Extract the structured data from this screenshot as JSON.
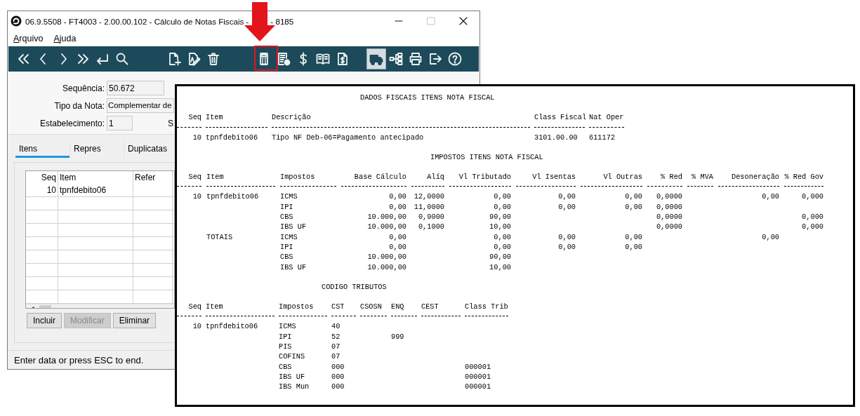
{
  "window": {
    "title": "06.9.5508 - FT4003 - 2.00.00.102 - Cálculo de Notas Fiscais -",
    "title_continued": "- 8185",
    "controls": [
      {
        "kind": "minimize",
        "disabled": false
      },
      {
        "kind": "maximize",
        "disabled": true
      },
      {
        "kind": "close",
        "disabled": false
      }
    ]
  },
  "menu": [
    {
      "label": "Arquivo"
    },
    {
      "label": "Ajuda"
    }
  ],
  "toolbar_groups": [
    {
      "buttons": [
        {
          "kind": "first",
          "selected": false
        },
        {
          "kind": "prev",
          "selected": false
        },
        {
          "kind": "next",
          "selected": false
        },
        {
          "kind": "last",
          "selected": false
        },
        {
          "kind": "enter",
          "selected": false
        },
        {
          "kind": "search",
          "selected": false
        }
      ]
    },
    {
      "buttons": [
        {
          "kind": "new",
          "selected": false
        },
        {
          "kind": "edit",
          "selected": false
        },
        {
          "kind": "delete",
          "selected": false
        }
      ]
    },
    {
      "buttons": [
        {
          "kind": "calculator",
          "selected": false
        },
        {
          "kind": "invoice",
          "selected": false
        },
        {
          "kind": "money",
          "selected": false
        },
        {
          "kind": "book",
          "selected": false
        },
        {
          "kind": "document",
          "selected": false
        }
      ]
    },
    {
      "buttons": [
        {
          "kind": "truck",
          "selected": true
        },
        {
          "kind": "tree",
          "selected": false
        },
        {
          "kind": "print",
          "selected": false
        },
        {
          "kind": "exit",
          "selected": false
        },
        {
          "kind": "help",
          "selected": false
        }
      ]
    }
  ],
  "form": {
    "rows": [
      [
        {
          "label": "Sequência:",
          "value": "50.672"
        }
      ],
      [
        {
          "label": "Tipo da Nota:",
          "value": "Complementar de"
        }
      ],
      [
        {
          "label": "Estabelecimento:",
          "value": "1"
        },
        {
          "label": "S"
        }
      ]
    ]
  },
  "tabs": [
    {
      "label": "Itens",
      "selected": true
    },
    {
      "label": "Repres",
      "selected": false
    },
    {
      "label": "Duplicatas",
      "selected": false
    }
  ],
  "items_grid": {
    "columns": [
      "Seq",
      "Item",
      "Refer"
    ],
    "rows": [
      [
        "10",
        "tpnfdebito06",
        null
      ]
    ]
  },
  "buttons": [
    {
      "label": "Incluir",
      "disabled": false
    },
    {
      "label": "Modificar",
      "disabled": true
    },
    {
      "label": "Eliminar",
      "disabled": false
    }
  ],
  "status_bar": "Enter data or press ESC to end.",
  "report": {
    "sections": [
      {
        "title": "DADOS FISCAIS ITENS NOTA FISCAL",
        "columns": [
          "Seq",
          "Item",
          "Descrição",
          "Class Fiscal",
          "Nat Oper"
        ],
        "rows": [
          [
            "10",
            "tpnfdebito06",
            "Tipo NF Deb-06=Pagamento antecipado",
            "3101.00.00",
            "611172"
          ]
        ]
      },
      {
        "title": "IMPOSTOS ITENS NOTA FISCAL",
        "columns": [
          "Seq",
          "Item",
          "Impostos",
          "Base Cálculo",
          "Alíq",
          "Vl Tributado",
          "Vl Isentas",
          "Vl Outras",
          "% Red",
          "% MVA",
          "Desoneração",
          "% Red Gov"
        ],
        "rows": [
          [
            "10",
            "tpnfdebito06",
            "ICMS",
            "0,00",
            "12,0000",
            "0,00",
            "0,00",
            "0,00",
            "0,0000",
            null,
            "0,00",
            "0,000"
          ],
          [
            null,
            null,
            "IPI",
            "0,00",
            "11,0000",
            "0,00",
            "0,00",
            "0,00",
            "0,0000",
            null,
            null,
            null
          ],
          [
            null,
            null,
            "CBS",
            "10.000,00",
            "0,9000",
            "90,00",
            null,
            null,
            "0,0000",
            null,
            null,
            "0,000"
          ],
          [
            null,
            null,
            "IBS UF",
            "10.000,00",
            "0,1000",
            "10,00",
            null,
            null,
            "0,0000",
            null,
            null,
            "0,000"
          ],
          [
            null,
            "TOTAIS",
            "ICMS",
            "0,00",
            null,
            "0,00",
            "0,00",
            "0,00",
            null,
            null,
            "0,00",
            null
          ],
          [
            null,
            null,
            "IPI",
            "0,00",
            null,
            "0,00",
            "0,00",
            "0,00",
            null,
            null,
            null,
            null
          ],
          [
            null,
            null,
            "CBS",
            "10.000,00",
            null,
            "90,00",
            null,
            null,
            null,
            null,
            null,
            null
          ],
          [
            null,
            null,
            "IBS UF",
            "10.000,00",
            null,
            "10,00",
            null,
            null,
            null,
            null,
            null,
            null
          ]
        ]
      },
      {
        "title": "CODIGO TRIBUTOS",
        "columns": [
          "Seq",
          "Item",
          "Impostos",
          "CST",
          "CSOSN",
          "ENQ",
          "CEST",
          "Class Trib"
        ],
        "rows": [
          [
            "10",
            "tpnfdebito06",
            "ICMS",
            "40",
            null,
            null,
            null,
            null
          ],
          [
            null,
            null,
            "IPI",
            "52",
            null,
            "999",
            null,
            null
          ],
          [
            null,
            null,
            "PIS",
            "07",
            null,
            null,
            null,
            null
          ],
          [
            null,
            null,
            "COFINS",
            "07",
            null,
            null,
            null,
            null
          ],
          [
            null,
            null,
            "CBS",
            "000",
            null,
            null,
            null,
            "000001"
          ],
          [
            null,
            null,
            "IBS UF",
            "000",
            null,
            null,
            null,
            "000001"
          ],
          [
            null,
            null,
            "IBS Mun",
            "000",
            null,
            null,
            null,
            "000001"
          ]
        ]
      }
    ]
  }
}
